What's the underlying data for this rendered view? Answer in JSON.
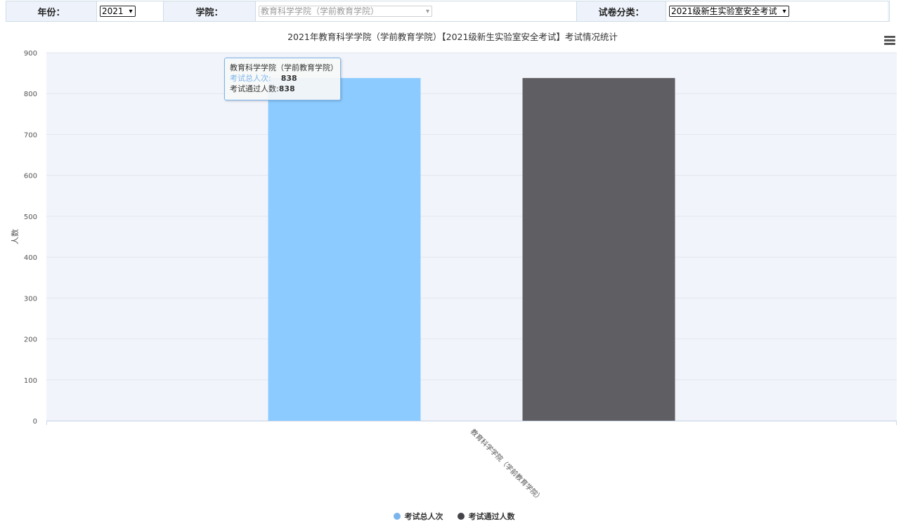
{
  "filters": {
    "year_label": "年份：",
    "year_value": "2021",
    "college_label": "学院：",
    "college_value": "教育科学学院（学前教育学院）",
    "paper_label": "试卷分类：",
    "paper_value": "2021级新生实验室安全考试"
  },
  "tooltip": {
    "category": "教育科学学院（学前教育学院）",
    "series1_label": "考试总人次:",
    "series1_value": "838",
    "series2_label": "考试通过人数:",
    "series2_value": "838"
  },
  "colors": {
    "series1": "#8ccbff",
    "series2": "#5f5e62",
    "plot_bg": "#f1f4fb",
    "legend1": "#7cb5ec",
    "legend2": "#434348"
  },
  "chart_data": {
    "type": "bar",
    "title": "2021年教育科学学院（学前教育学院）【2021级新生实验室安全考试】考试情况统计",
    "ylabel": "人数",
    "xlabel": "",
    "categories": [
      "教育科学学院（学前教育学院）"
    ],
    "series": [
      {
        "name": "考试总人次",
        "values": [
          838
        ]
      },
      {
        "name": "考试通过人数",
        "values": [
          838
        ]
      }
    ],
    "ylim": [
      0,
      900
    ],
    "yticks": [
      0,
      100,
      200,
      300,
      400,
      500,
      600,
      700,
      800,
      900
    ],
    "grid": true,
    "legend": "bottom-center"
  }
}
